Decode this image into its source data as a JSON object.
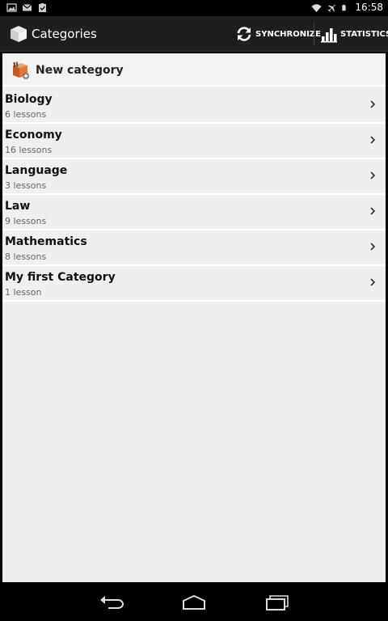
{
  "status_bar": {
    "time": "16:58",
    "left_icons": [
      "image-icon",
      "gmail-icon",
      "clipboard-check-icon"
    ],
    "right_icons": [
      "wifi-icon",
      "airplane-icon",
      "battery-icon"
    ]
  },
  "action_bar": {
    "title": "Categories",
    "sync_label": "SYNCHRONIZE",
    "stats_label": "STATISTICS"
  },
  "new_category": {
    "label": "New category"
  },
  "categories": [
    {
      "name": "Biology",
      "lessons": "6 lessons"
    },
    {
      "name": "Economy",
      "lessons": "16 lessons"
    },
    {
      "name": "Language",
      "lessons": "3 lessons"
    },
    {
      "name": "Law",
      "lessons": "9 lessons"
    },
    {
      "name": "Mathematics",
      "lessons": "8 lessons"
    },
    {
      "name": "My first Category",
      "lessons": "1 lesson"
    }
  ],
  "nav_bar": {
    "buttons": [
      "back-icon",
      "home-icon",
      "recents-icon"
    ]
  }
}
